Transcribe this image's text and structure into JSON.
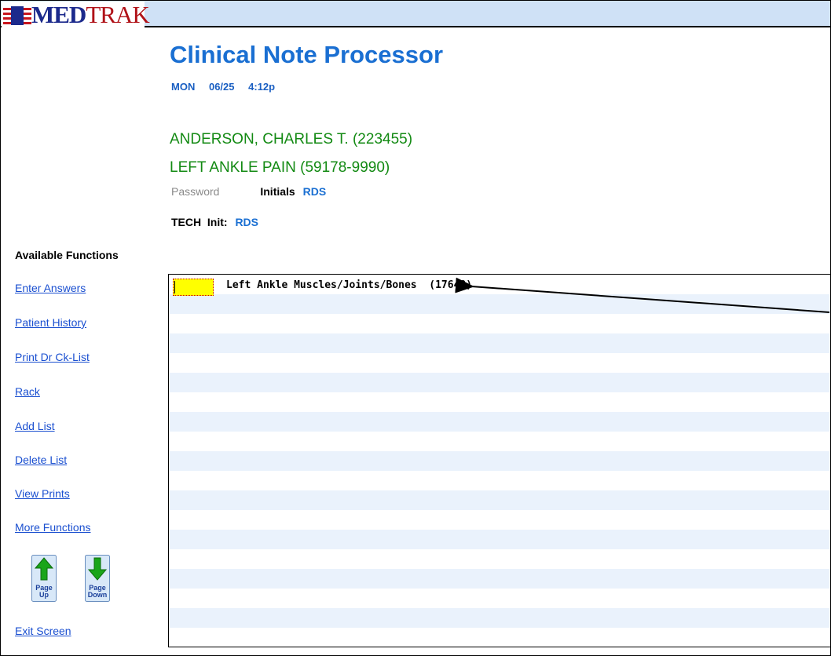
{
  "app": {
    "logo_text_med": "MED",
    "logo_text_trak": "TRAK"
  },
  "header": {
    "title": "Clinical Note Processor",
    "day": "MON",
    "date": "06/25",
    "time": "4:12p"
  },
  "patient": {
    "name_line": "ANDERSON, CHARLES T. (223455)",
    "complaint_line": "LEFT ANKLE PAIN (59178-9990)"
  },
  "auth": {
    "password_label": "Password",
    "initials_label": "Initials",
    "initials_value": "RDS",
    "tech_label": "TECH  Init:",
    "tech_value": "RDS"
  },
  "functions": {
    "heading": "Available Functions",
    "items": [
      {
        "label": "Enter Answers"
      },
      {
        "label": "Patient History"
      },
      {
        "label": "Print Dr Ck-List"
      },
      {
        "label": "Rack"
      },
      {
        "label": "Add List"
      },
      {
        "label": "Delete List"
      },
      {
        "label": "View Prints"
      },
      {
        "label": "More Functions"
      }
    ],
    "page_up_label_1": "Page",
    "page_up_label_2": "Up",
    "page_down_label_1": "Page",
    "page_down_label_2": "Down",
    "exit_label": "Exit Screen"
  },
  "panel": {
    "first_entry": "Left Ankle Muscles/Joints/Bones  (17648)",
    "input_value": ""
  },
  "colors": {
    "title_blue": "#1a6fd2",
    "patient_green": "#138a13",
    "link_blue": "#1a4fd0",
    "row_alt": "#eaf2fc",
    "cursor_yellow": "#ffff00",
    "topbar": "#cfe1f6"
  }
}
